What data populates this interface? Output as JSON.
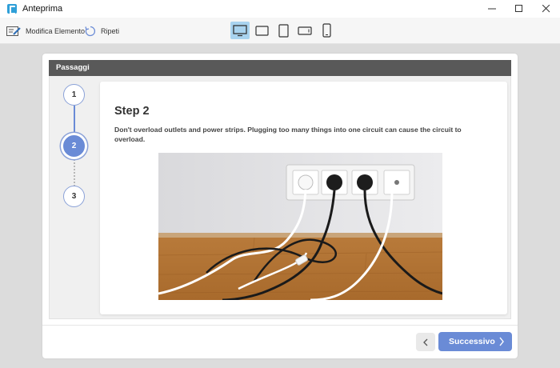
{
  "window": {
    "title": "Anteprima"
  },
  "toolbar": {
    "edit_label": "Modifica Elemento",
    "redo_label": "Ripeti",
    "devices": [
      "desktop-icon",
      "tablet-landscape-icon",
      "tablet-portrait-icon",
      "phone-landscape-icon",
      "phone-portrait-icon"
    ],
    "active_device": "desktop-icon"
  },
  "panel": {
    "header": "Passaggi",
    "steps": [
      "1",
      "2",
      "3"
    ],
    "current_step": "2"
  },
  "content": {
    "title": "Step 2",
    "description": "Don't overload outlets and power strips. Plugging too many things into one circuit can cause the circuit to overload."
  },
  "footer": {
    "next_label": "Successivo"
  },
  "colors": {
    "accent": "#6a8bd6",
    "header_bg": "#595959",
    "active_device_bg": "#a9d3ef"
  }
}
